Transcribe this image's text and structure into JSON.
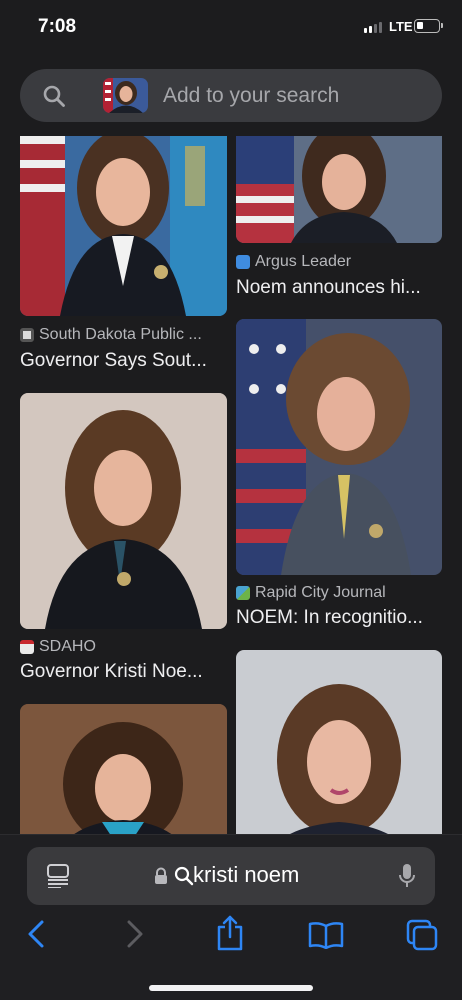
{
  "status_bar": {
    "time": "7:08",
    "network": "LTE",
    "signal_bars": 2,
    "battery_level": 0.2
  },
  "search": {
    "placeholder": "Add to your search"
  },
  "results": [
    {
      "source": "South Dakota Public ...",
      "title": "Governor Says Sout..."
    },
    {
      "source": "Argus Leader",
      "title": "Noem announces hi..."
    },
    {
      "source": "Rapid City Journal",
      "title": "NOEM: In recognitio..."
    },
    {
      "source": "SDAHO",
      "title": "Governor Kristi Noe..."
    }
  ],
  "url_bar": {
    "query": "kristi noem"
  },
  "toolbar": {
    "icons": [
      "reader-icon",
      "lock-icon",
      "search-icon",
      "microphone-icon",
      "back-icon",
      "forward-icon",
      "share-icon",
      "bookmarks-icon",
      "tabs-icon"
    ]
  },
  "colors": {
    "accent": "#2e86f5",
    "background": "#1c1c1e",
    "pill": "#3a3b3f"
  }
}
